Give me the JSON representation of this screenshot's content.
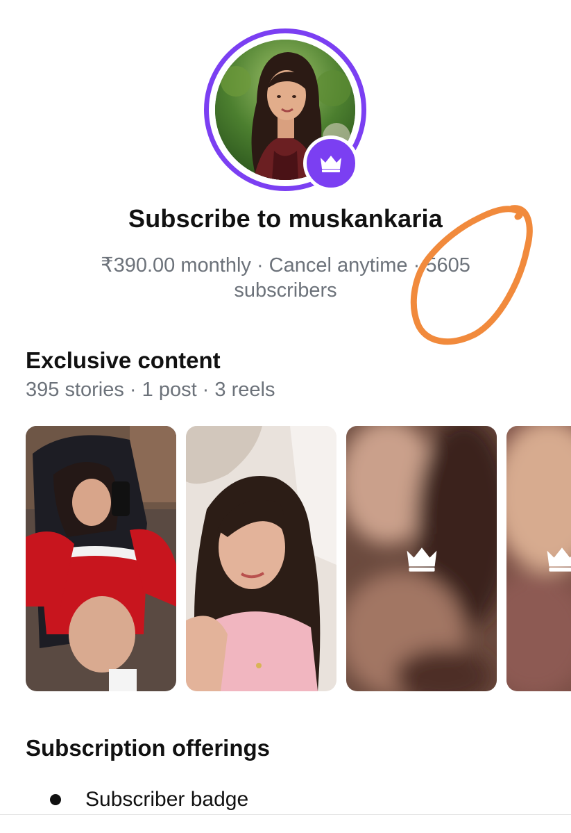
{
  "profile": {
    "avatar_alt": "muskankaria profile photo",
    "badge_icon": "crown-icon",
    "ring_color": "#7b3ff2"
  },
  "header": {
    "title": "Subscribe to muskankaria",
    "price": "₹390.00 monthly",
    "separator": " · ",
    "cancel_note": "Cancel anytime",
    "subscriber_count": "5605",
    "subscriber_label": "subscribers"
  },
  "exclusive": {
    "title": "Exclusive content",
    "meta": "395 stories · 1 post · 3 reels",
    "thumbnails": [
      {
        "kind": "photo",
        "locked": false
      },
      {
        "kind": "photo",
        "locked": false
      },
      {
        "kind": "blurred",
        "locked": true,
        "icon": "crown-icon"
      },
      {
        "kind": "blurred",
        "locked": true,
        "icon": "crown-icon"
      }
    ]
  },
  "offerings": {
    "title": "Subscription offerings",
    "items": [
      "Subscriber badge"
    ]
  },
  "annotation": {
    "shape": "hand-drawn circle",
    "color": "#f18a3c"
  }
}
